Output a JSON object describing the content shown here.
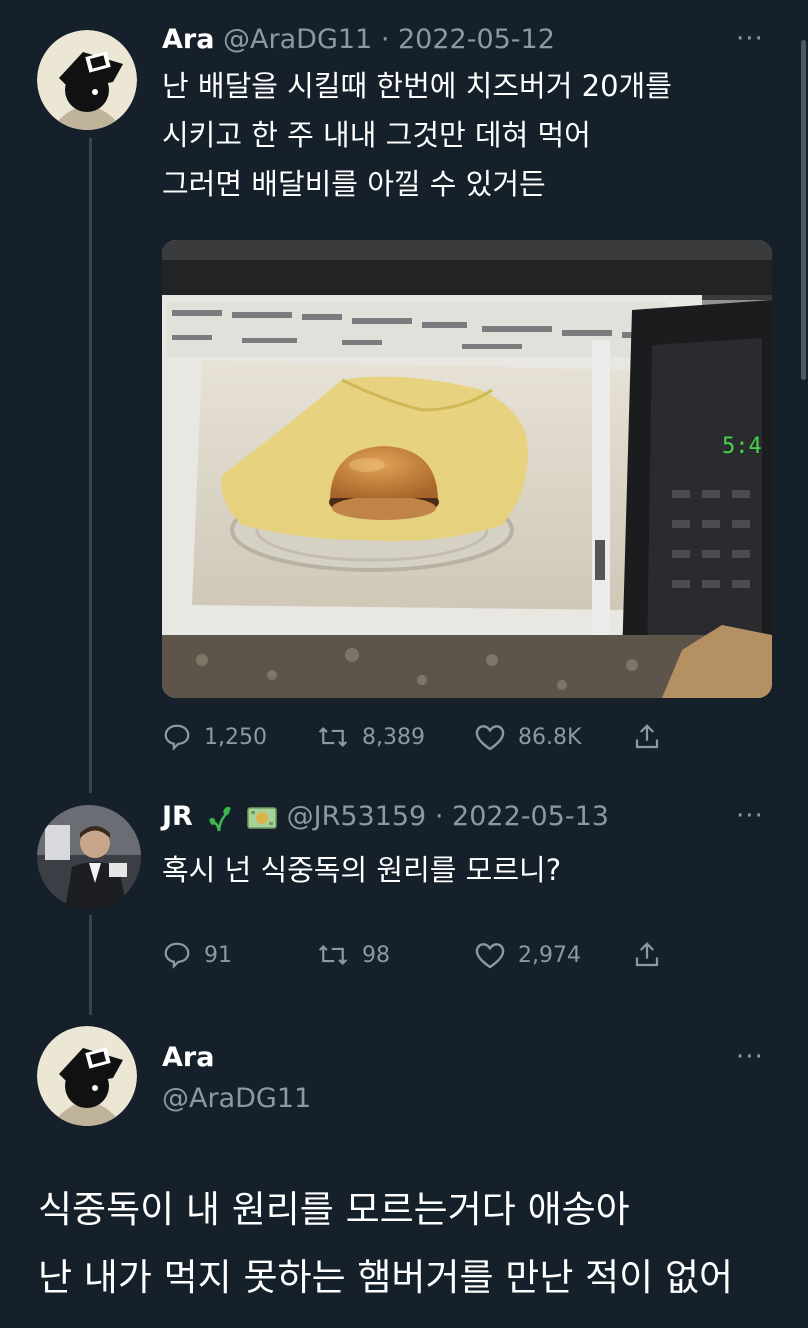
{
  "tweet1": {
    "name": "Ara",
    "handle": "@AraDG11",
    "separator": "·",
    "date": "2022-05-12",
    "more": "···",
    "lines": [
      "난 배달을 시킬때 한번에 치즈버거 20개를",
      "시키고 한 주 내내 그것만 데혀 먹어",
      "그러면 배달비를 아낄 수 있거든"
    ],
    "microwave_display": "5:4",
    "replies": "1,250",
    "retweets": "8,389",
    "likes": "86.8K"
  },
  "tweet2": {
    "name": "JR",
    "handle": "@JR53159",
    "separator": "·",
    "date": "2022-05-13",
    "more": "···",
    "text": "혹시 넌 식중독의 원리를 모르니?",
    "replies": "91",
    "retweets": "98",
    "likes": "2,974"
  },
  "tweet3": {
    "name": "Ara",
    "handle": "@AraDG11",
    "more": "···",
    "lines": [
      "식중독이 내 원리를 모르는거다 애송아",
      "난 내가 먹지 못하는 햄버거를 만난 적이 없어"
    ]
  },
  "colors": {
    "background": "#15202b",
    "text": "#ffffff",
    "secondary": "#8b98a5",
    "thread_line": "#38444d"
  }
}
